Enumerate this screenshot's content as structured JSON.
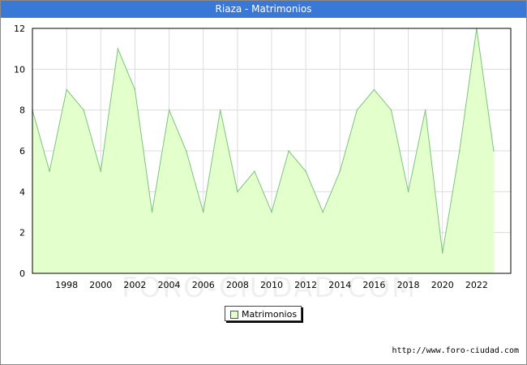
{
  "header": {
    "title": "Riaza - Matrimonios"
  },
  "footer": {
    "source": "http://www.foro-ciudad.com"
  },
  "watermark": "FORO-CIUDAD.COM",
  "colors": {
    "titlebar": "#3a78d8",
    "fill": "#e3ffcc",
    "line": "#7cc47c",
    "grid": "#dcdcdc"
  },
  "chart_data": {
    "type": "area",
    "title": "Riaza - Matrimonios",
    "xlabel": "",
    "ylabel": "",
    "x": [
      1996,
      1997,
      1998,
      1999,
      2000,
      2001,
      2002,
      2003,
      2004,
      2005,
      2006,
      2007,
      2008,
      2009,
      2010,
      2011,
      2012,
      2013,
      2014,
      2015,
      2016,
      2017,
      2018,
      2019,
      2020,
      2021,
      2022,
      2023
    ],
    "series": [
      {
        "name": "Matrimonios",
        "values": [
          8,
          5,
          9,
          8,
          5,
          11,
          9,
          3,
          8,
          6,
          3,
          8,
          4,
          5,
          3,
          6,
          5,
          3,
          5,
          8,
          9,
          8,
          4,
          8,
          1,
          6,
          12,
          6
        ]
      }
    ],
    "x_ticks": [
      "1998",
      "2000",
      "2002",
      "2004",
      "2006",
      "2008",
      "2010",
      "2012",
      "2014",
      "2016",
      "2018",
      "2020",
      "2022"
    ],
    "y_ticks": [
      "0",
      "2",
      "4",
      "6",
      "8",
      "10",
      "12"
    ],
    "xlim": [
      1996,
      2024
    ],
    "ylim": [
      0,
      12
    ],
    "grid": true,
    "legend": "bottom-center"
  }
}
